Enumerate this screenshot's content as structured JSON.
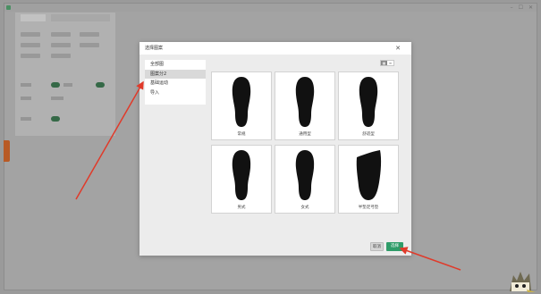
{
  "window": {
    "title": "",
    "controls": [
      "–",
      "☐",
      "✕"
    ]
  },
  "background_panel": {
    "tabs": [
      "",
      ""
    ]
  },
  "dialog": {
    "title": "选择图案",
    "close_icon": "close-icon",
    "sidebar": {
      "items": [
        {
          "label": "全部图",
          "active": false
        },
        {
          "label": "图案分2",
          "active": true
        },
        {
          "label": "基础运动",
          "active": false
        },
        {
          "label": "导入",
          "active": false
        }
      ]
    },
    "view_toggle": {
      "grid_icon": "grid-view-icon",
      "list_icon": "list-view-icon"
    },
    "cards": [
      {
        "label": "常规",
        "shape": "insole"
      },
      {
        "label": "通用型",
        "shape": "insole"
      },
      {
        "label": "舒适型",
        "shape": "insole"
      },
      {
        "label": "男式",
        "shape": "insole"
      },
      {
        "label": "女式",
        "shape": "insole"
      },
      {
        "label": "半垫足弓垫",
        "shape": "half-insole"
      }
    ],
    "footer": {
      "cancel_label": "取消",
      "select_label": "选择"
    }
  },
  "colors": {
    "accent": "#2f9c69",
    "annotation_arrow": "#e03a2a",
    "overlay": "#9a9a9a"
  }
}
